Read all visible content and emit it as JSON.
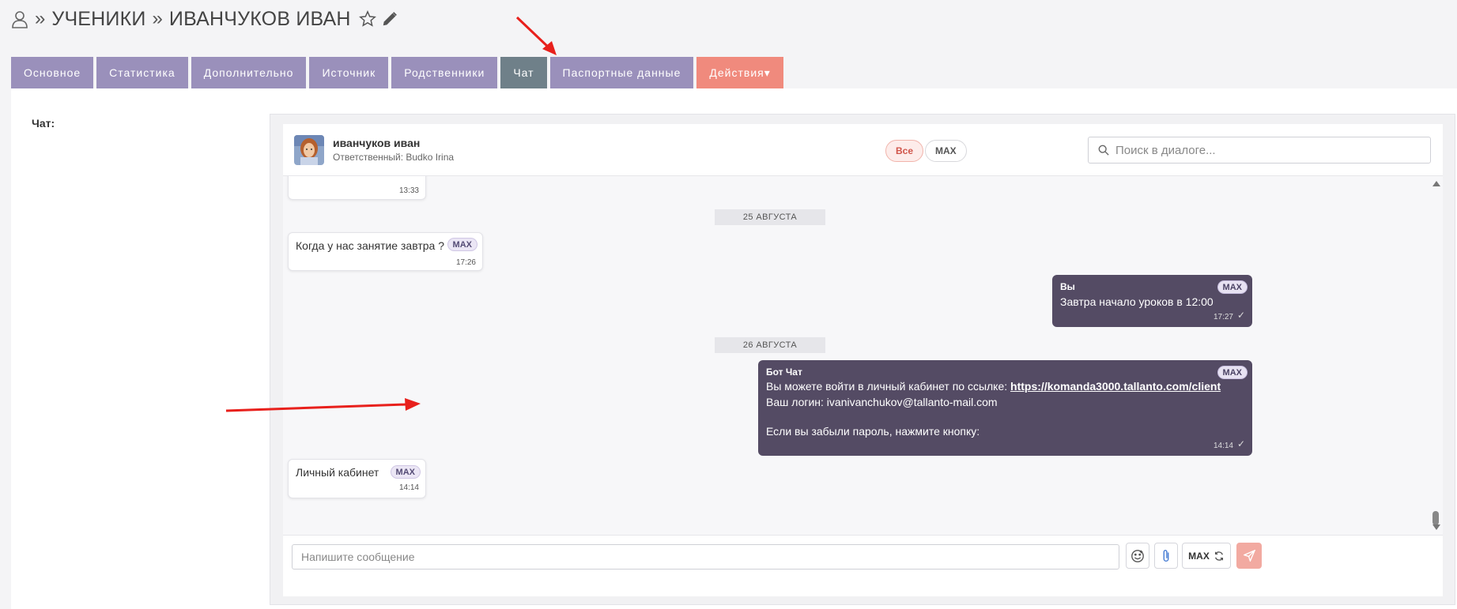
{
  "header": {
    "crumbs": [
      "УЧЕНИКИ",
      "ИВАНЧУКОВ ИВАН"
    ],
    "separator": "»"
  },
  "tabs": [
    {
      "label": "Основное"
    },
    {
      "label": "Статистика"
    },
    {
      "label": "Дополнительно"
    },
    {
      "label": "Источник"
    },
    {
      "label": "Родственники"
    },
    {
      "label": "Чат"
    },
    {
      "label": "Паспортные данные"
    },
    {
      "label": "Действия▾"
    }
  ],
  "section_label": "Чат:",
  "chat": {
    "contact_name": "иванчуков иван",
    "responsible": "Ответственный: Budko Irina",
    "filters": {
      "all": "Все",
      "max": "MAX"
    },
    "search_placeholder": "Поиск в диалоге...",
    "messages": [
      {
        "time": "13:33"
      },
      {
        "date": "25 АВГУСТА"
      },
      {
        "text": "Когда у нас занятие завтра ?",
        "badge": "MAX",
        "time": "17:26"
      },
      {
        "sender": "Вы",
        "text": "Завтра начало уроков в 12:00",
        "badge": "MAX",
        "time": "17:27",
        "check": "✓"
      },
      {
        "date": "26 АВГУСТА"
      },
      {
        "sender": "Бот Чат",
        "line1_prefix": "Вы можете войти в личный кабинет по ссылке: ",
        "link": "https://komanda3000.tallanto.com/client",
        "line2": "Ваш логин: ivanivanchukov@tallanto-mail.com",
        "line3": "Если вы забыли пароль, нажмите кнопку:",
        "badge": "MAX",
        "time": "14:14",
        "check": "✓"
      },
      {
        "text": "Личный кабинет",
        "badge": "MAX",
        "time": "14:14"
      }
    ],
    "composer": {
      "placeholder": "Напишите сообщение",
      "channel": "MAX"
    }
  },
  "colors": {
    "tab": "#9a90bb",
    "tab_active": "#6f8089",
    "tab_actions": "#f08a7d",
    "outgoing_bubble": "#544b64",
    "annotation_arrow": "#e8201c"
  }
}
